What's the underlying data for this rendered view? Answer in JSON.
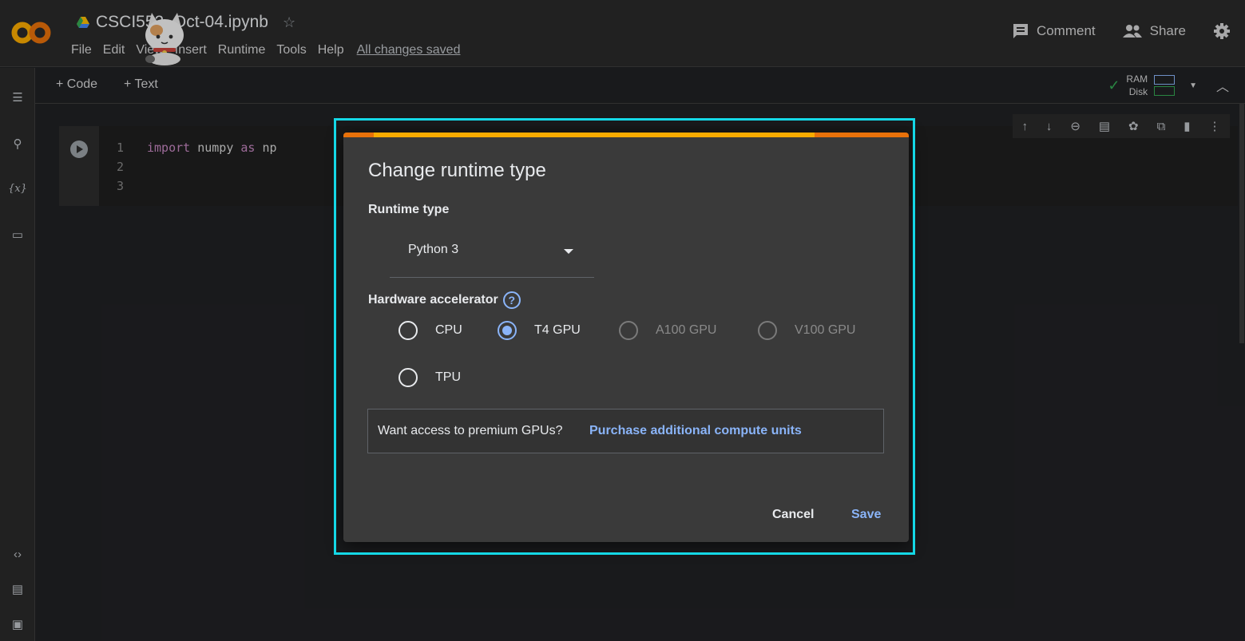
{
  "header": {
    "notebook_title": "CSCI552_Oct-04.ipynb",
    "menu": [
      "File",
      "Edit",
      "View",
      "Insert",
      "Runtime",
      "Tools",
      "Help"
    ],
    "save_status": "All changes saved",
    "comment_label": "Comment",
    "share_label": "Share"
  },
  "toolbar": {
    "add_code": "+ Code",
    "add_text": "+ Text",
    "ram_label": "RAM",
    "disk_label": "Disk"
  },
  "cell": {
    "line_numbers": [
      "1",
      "2",
      "3"
    ],
    "code_kw1": "import",
    "code_mid": " numpy ",
    "code_kw2": "as",
    "code_end": " np"
  },
  "dialog": {
    "title": "Change runtime type",
    "runtime_section": "Runtime type",
    "runtime_value": "Python 3",
    "accelerator_section": "Hardware accelerator",
    "options": [
      {
        "label": "CPU",
        "state": "unselected"
      },
      {
        "label": "T4 GPU",
        "state": "selected"
      },
      {
        "label": "A100 GPU",
        "state": "disabled"
      },
      {
        "label": "V100 GPU",
        "state": "disabled"
      },
      {
        "label": "TPU",
        "state": "unselected"
      }
    ],
    "premium_question": "Want access to premium GPUs?",
    "premium_link": "Purchase additional compute units",
    "cancel_label": "Cancel",
    "save_label": "Save"
  },
  "colors": {
    "accent": "#8ab4f8",
    "highlight": "#14d8e6",
    "bar_orange": "#e8710a",
    "bar_yellow": "#f9ab00"
  }
}
